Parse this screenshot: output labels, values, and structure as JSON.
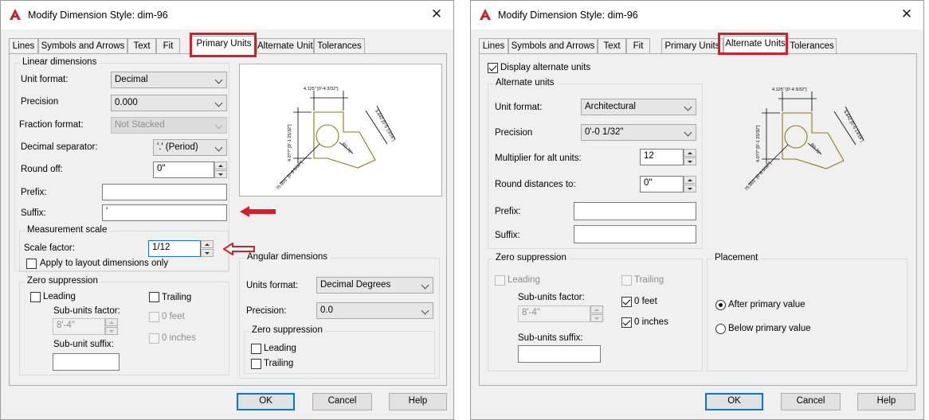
{
  "dialog_title": "Modify Dimension Style: dim-96",
  "close_glyph": "✕",
  "tabs": [
    "Lines",
    "Symbols and Arrows",
    "Text",
    "Fit",
    "Primary Units",
    "Alternate Units",
    "Tolerances"
  ],
  "buttons": {
    "ok": "OK",
    "cancel": "Cancel",
    "help": "Help"
  },
  "preview_labels": {
    "top": "4.125\" [0'-4 3/32\"]",
    "left": "4.0??\" [0'-1 25/32\"]",
    "right": "5.842 [0'-5 13/16\"]",
    "radius": "R0.75\"",
    "diag": "75.955\" [0'-6 5/32\"]"
  },
  "primary": {
    "linear_title": "Linear dimensions",
    "unit_format_label": "Unit format:",
    "unit_format": "Decimal",
    "precision_label": "Precision",
    "precision": "0.000",
    "fraction_label": "Fraction format:",
    "fraction": "Not Stacked",
    "decimal_sep_label": "Decimal separator:",
    "decimal_sep": "'.' (Period)",
    "round_label": "Round off:",
    "round": "0\"",
    "prefix_label": "Prefix:",
    "prefix": "",
    "suffix_label": "Suffix:",
    "suffix": "'",
    "measurement_title": "Measurement scale",
    "scale_label": "Scale factor:",
    "scale": "1/12",
    "apply_layout_label": "Apply to layout dimensions only",
    "zero_title": "Zero suppression",
    "leading": "Leading",
    "trailing": "Trailing",
    "subunits_factor_label": "Sub-units factor:",
    "subunits_factor": "8'-4\"",
    "zero_feet": "0 feet",
    "zero_inches": "0 inches",
    "subunit_suffix_label": "Sub-unit suffix:",
    "angular_title": "Angular dimensions",
    "angular_format_label": "Units format:",
    "angular_format": "Decimal Degrees",
    "angular_precision_label": "Precision:",
    "angular_precision": "0.0",
    "angular_zero_title": "Zero suppression",
    "angular_leading": "Leading",
    "angular_trailing": "Trailing"
  },
  "alternate": {
    "display_label": "Display alternate units",
    "units_title": "Alternate units",
    "unit_format_label": "Unit format:",
    "unit_format": "Architectural",
    "precision_label": "Precision",
    "precision": "0'-0 1/32\"",
    "multiplier_label": "Multiplier for alt units:",
    "multiplier": "12",
    "round_label": "Round distances  to:",
    "round": "0\"",
    "prefix_label": "Prefix:",
    "suffix_label": "Suffix:",
    "zero_title": "Zero suppression",
    "leading": "Leading",
    "trailing": "Trailing",
    "subunits_factor_label": "Sub-units factor:",
    "subunits_factor": "8'-4\"",
    "zero_feet": "0 feet",
    "zero_inches": "0 inches",
    "subunits_suffix_label": "Sub-units suffix:",
    "placement_title": "Placement",
    "after_primary": "After primary value",
    "below_primary": "Below primary value"
  },
  "colors": {
    "highlight": "#d41f2a",
    "preview_stroke": "#8a7d10",
    "focus": "#1479d4"
  }
}
